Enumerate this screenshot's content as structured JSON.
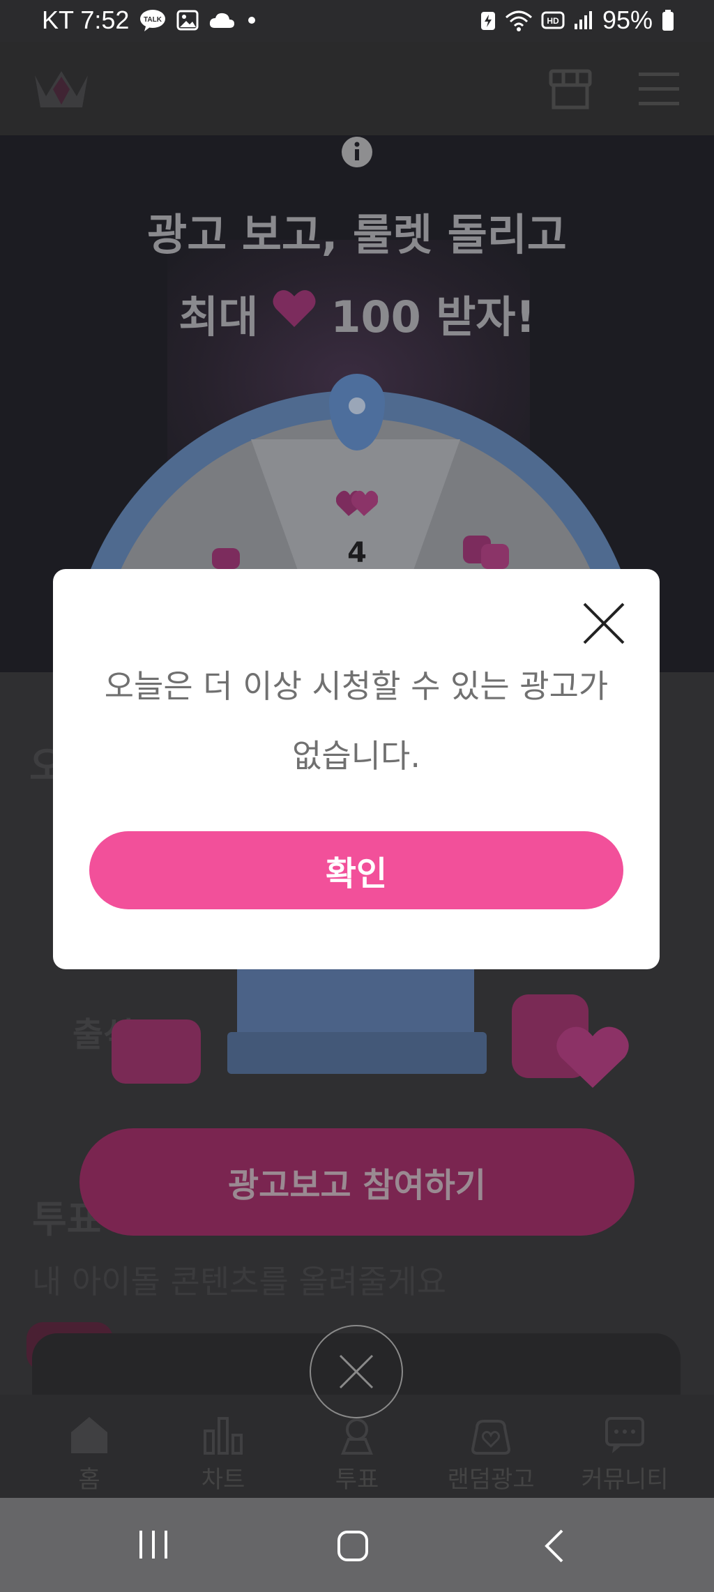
{
  "status_bar": {
    "carrier_time": "KT 7:52",
    "battery": "95%",
    "talk_badge": "TALK",
    "network_badge": "HD"
  },
  "hero": {
    "title_line1": "광고 보고, 룰렛 돌리고",
    "title_line2_pre": "최대",
    "title_line2_post": "100 받자!",
    "wheel_center_value": "4"
  },
  "main": {
    "ad_button_label": "광고보고 참여하기",
    "background_section_title_1": "오",
    "background_attendance": "출석",
    "background_section_title_2": "투표",
    "background_subtitle": "내 아이돌 콘텐츠를 올려줄게요",
    "background_tag": "투표"
  },
  "bottom_nav": {
    "items": [
      {
        "label": "홈",
        "icon": "home-icon"
      },
      {
        "label": "차트",
        "icon": "chart-icon"
      },
      {
        "label": "투표",
        "icon": "vote-icon"
      },
      {
        "label": "랜덤광고",
        "icon": "random-ad-icon"
      },
      {
        "label": "커뮤니티",
        "icon": "community-icon"
      }
    ]
  },
  "dialog": {
    "message_line1": "오늘은 더 이상 시청할 수 있는 광고가",
    "message_line2": "없습니다.",
    "confirm_label": "확인"
  },
  "colors": {
    "accent_pink": "#f2509a",
    "dim_overlay": "#2e2e30"
  }
}
